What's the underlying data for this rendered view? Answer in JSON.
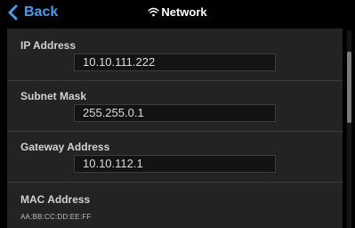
{
  "header": {
    "back_label": "Back",
    "title": "Network",
    "title_icon": "wifi-icon",
    "accent_color": "#4a9be8"
  },
  "fields": {
    "ip": {
      "label": "IP Address",
      "value": "10.10.111.222"
    },
    "subnet": {
      "label": "Subnet Mask",
      "value": "255.255.0.1"
    },
    "gateway": {
      "label": "Gateway Address",
      "value": "10.10.112.1"
    },
    "mac": {
      "label": "MAC Address",
      "value": "AA:BB:CC:DD:EE:FF"
    }
  }
}
